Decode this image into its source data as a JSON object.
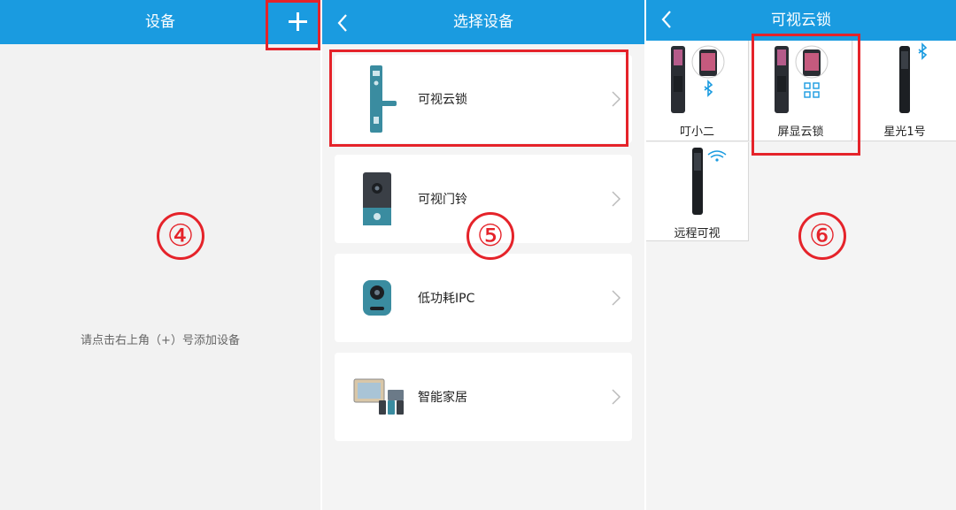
{
  "panel1": {
    "title": "设备",
    "empty_hint": "请点击右上角（+）号添加设备",
    "step": "④"
  },
  "panel2": {
    "title": "选择设备",
    "step": "⑤",
    "items": [
      {
        "label": "可视云锁",
        "icon": "smart-lock-icon"
      },
      {
        "label": "可视门铃",
        "icon": "video-doorbell-icon"
      },
      {
        "label": "低功耗IPC",
        "icon": "ipc-camera-icon"
      },
      {
        "label": "智能家居",
        "icon": "smart-home-icon"
      }
    ]
  },
  "panel3": {
    "title": "可视云锁",
    "step": "⑥",
    "devices": [
      {
        "label": "叮小二",
        "icon": "lock-with-bluetooth-icon"
      },
      {
        "label": "屏显云锁",
        "icon": "lock-with-qrcode-icon"
      },
      {
        "label": "星光1号",
        "icon": "lock-slim-bluetooth-icon"
      },
      {
        "label": "远程可视",
        "icon": "lock-wifi-icon"
      }
    ]
  },
  "colors": {
    "header": "#1a9be0",
    "highlight": "#e5232a",
    "device_teal": "#3a8ca0"
  }
}
